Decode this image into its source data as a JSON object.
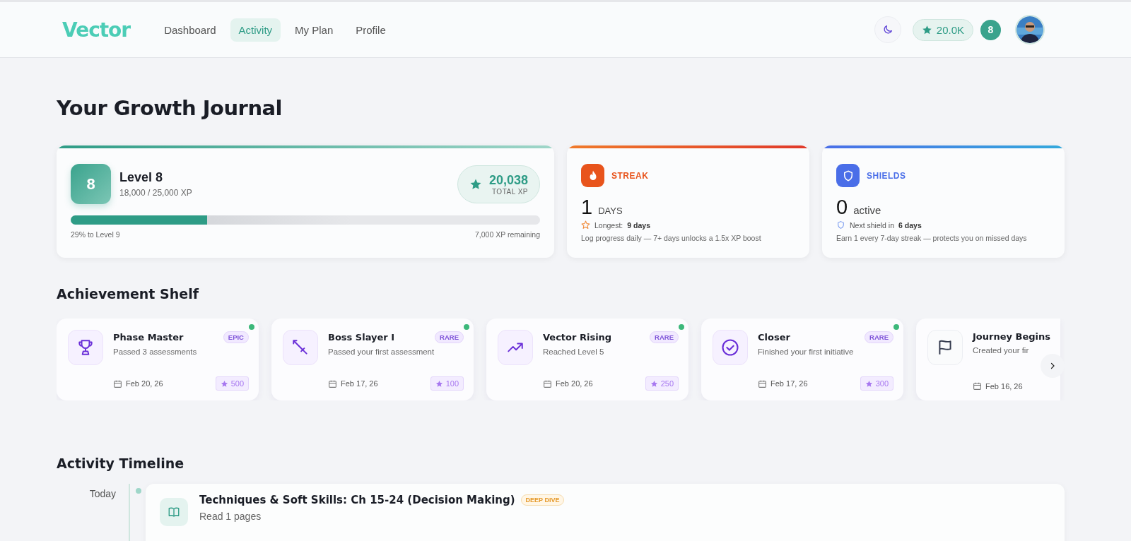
{
  "nav": {
    "logo": "Vector",
    "tabs": [
      {
        "label": "Dashboard",
        "selected": false
      },
      {
        "label": "Activity",
        "selected": true
      },
      {
        "label": "My Plan",
        "selected": false
      },
      {
        "label": "Profile",
        "selected": false
      }
    ],
    "points": "20.0K",
    "level_badge": "8"
  },
  "page_title": "Your Growth Journal",
  "level_card": {
    "level": "8",
    "title": "Level 8",
    "xp": "18,000 / 25,000 XP",
    "total_xp": "20,038",
    "total_label": "TOTAL XP",
    "progress": {
      "level": 0.29
    },
    "progress_left": "29% to Level 9",
    "progress_right": "7,000 XP remaining"
  },
  "stat_cards": [
    {
      "kind": "streak",
      "label": "STREAK",
      "value": "1",
      "unit": "DAYS",
      "detail_label": "Longest:",
      "detail_value": "9 days",
      "note": "Log progress daily — 7+ days unlocks a 1.5x XP boost",
      "color": "#e8541c"
    },
    {
      "kind": "shields",
      "label": "SHIELDS",
      "value": "0",
      "unit": "active",
      "detail_label": "Next shield in",
      "detail_value": "6 days",
      "note": "Earn 1 every 7-day streak — protects you on missed days",
      "color": "#4a6ee8"
    }
  ],
  "achievements": {
    "title": "Achievement Shelf",
    "items": [
      {
        "kind": "trophy",
        "title": "Phase Master",
        "rarity": "EPIC",
        "description": "Passed 3 assessments",
        "date": "Feb 20, 26",
        "points": "500",
        "new": true
      },
      {
        "kind": "sword",
        "title": "Boss Slayer I",
        "rarity": "RARE",
        "description": "Passed your first assessment",
        "date": "Feb 17, 26",
        "points": "100",
        "new": true
      },
      {
        "kind": "trend",
        "title": "Vector Rising",
        "rarity": "RARE",
        "description": "Reached Level 5",
        "date": "Feb 20, 26",
        "points": "250",
        "new": true
      },
      {
        "kind": "check",
        "title": "Closer",
        "rarity": "RARE",
        "description": "Finished your first initiative",
        "date": "Feb 17, 26",
        "points": "300",
        "new": true
      },
      {
        "kind": "flag",
        "title": "Journey Begins",
        "description": "Created your fir",
        "date": "Feb 16, 26",
        "new": false
      }
    ]
  },
  "timeline": {
    "title": "Activity Timeline",
    "groups": [
      {
        "date": "Today",
        "entries": [
          {
            "title": "Techniques & Soft Skills: Ch 15-24 (Decision Making)",
            "tag": "DEEP DIVE",
            "detail": "Read 1 pages"
          }
        ]
      }
    ]
  }
}
